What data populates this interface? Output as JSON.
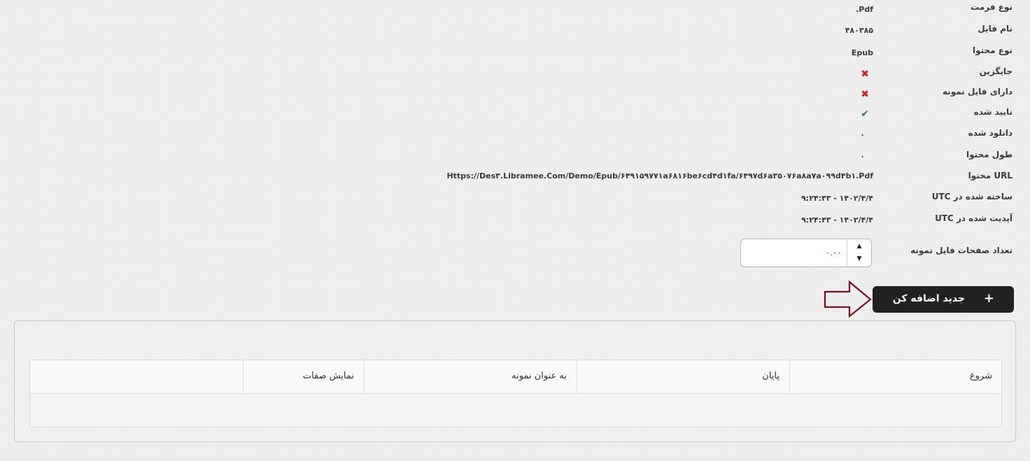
{
  "details": [
    {
      "label": "نوع فرمت",
      "value": ".Pdf"
    },
    {
      "label": "نام فایل",
      "value": "۴۸۰۳۸۵"
    },
    {
      "label": "نوع محتوا",
      "value": "Epub"
    },
    {
      "label": "جایگزین",
      "value": "✖"
    },
    {
      "label": "دارای فایل نمونه",
      "value": "✖"
    },
    {
      "label": "تایید شده",
      "value": "✔"
    },
    {
      "label": "دانلود شده",
      "value": "۰"
    },
    {
      "label": "طول محتوا",
      "value": "۰"
    },
    {
      "label": "URL محتوا",
      "value": "Https://Des۳.Libramee.Com/Demo/Epub/۶۴۹۱۵۹۷۷۱a۶۸۱۶be۶cd۴d۱fa/۶۴۹۷d۶a۳۵۰۷۶a۸a۷a۰۹۹d۴b۱.Pdf"
    },
    {
      "label": "ساخته شده در UTC",
      "value": "۹:۲۴:۴۳ - ۱۴۰۲/۴/۴"
    },
    {
      "label": "آپدیت شده در UTC",
      "value": "۹:۲۴:۴۳ - ۱۴۰۲/۴/۴"
    }
  ],
  "sample_pages": {
    "label": "تعداد صفحات فایل نمونه",
    "value": "۰.۰۰",
    "up_glyph": "▲",
    "down_glyph": "▼"
  },
  "add_button": {
    "label": "جدید اضافه کن",
    "icon": "+"
  },
  "table": {
    "columns": [
      "شروع",
      "پایان",
      "به عنوان نمونه",
      "نمایش صفات",
      ""
    ]
  },
  "colors": {
    "background": "#f0f0f0",
    "button": "#212121",
    "arrow": "#7a1020",
    "cross": "#d42020",
    "check": "#1a8a1a"
  }
}
